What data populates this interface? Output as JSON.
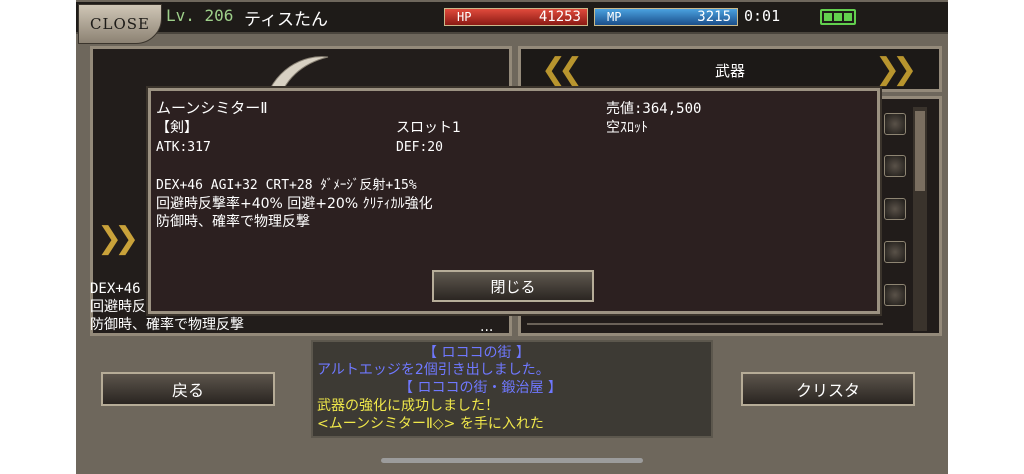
{
  "header": {
    "close_label": "CLOSE",
    "level": "Lv. 206",
    "player_name": "ティスたん",
    "hp_label": "HP",
    "hp_value": "41253",
    "mp_label": "MP",
    "mp_value": "3215",
    "timer": "0:01"
  },
  "category": {
    "label": "武器",
    "prev_icon": "double-chevron-left",
    "next_icon": "double-chevron-right"
  },
  "popup": {
    "item_name": "ムーンシミターⅡ",
    "type": "【剣】",
    "slot": "スロット1",
    "sell_price": "売値:364,500",
    "slot_state": "空ｽﾛｯﾄ",
    "atk": "ATK:317",
    "def": "DEF:20",
    "bonus_line1": "DEX+46 AGI+32 CRT+28 ﾀﾞﾒｰｼﾞ反射+15%",
    "bonus_line2": "回避時反撃率+40% 回避+20% ｸﾘﾃｨｶﾙ強化",
    "bonus_line3": "防御時、確率で物理反撃",
    "close_button": "閉じる"
  },
  "under_panel": {
    "line1": "DEX+46",
    "line2": "回避時反",
    "line3": "防御時、確率で物理反撃",
    "ellipsis": "..."
  },
  "log": {
    "line1": "【 ロココの街 】",
    "line2": "アルトエッジを2個引き出しました。",
    "line3": "【 ロココの街・鍛治屋 】",
    "line4": "武器の強化に成功しました！",
    "line5": "<ムーンシミターⅡ◇> を手に入れた"
  },
  "buttons": {
    "back": "戻る",
    "crysta": "クリスタ"
  },
  "colors": {
    "accent_gold": "#b8952e",
    "log_blue": "#6f78ff",
    "log_yellow": "#f0e84a",
    "level_green": "#9ed08a"
  }
}
